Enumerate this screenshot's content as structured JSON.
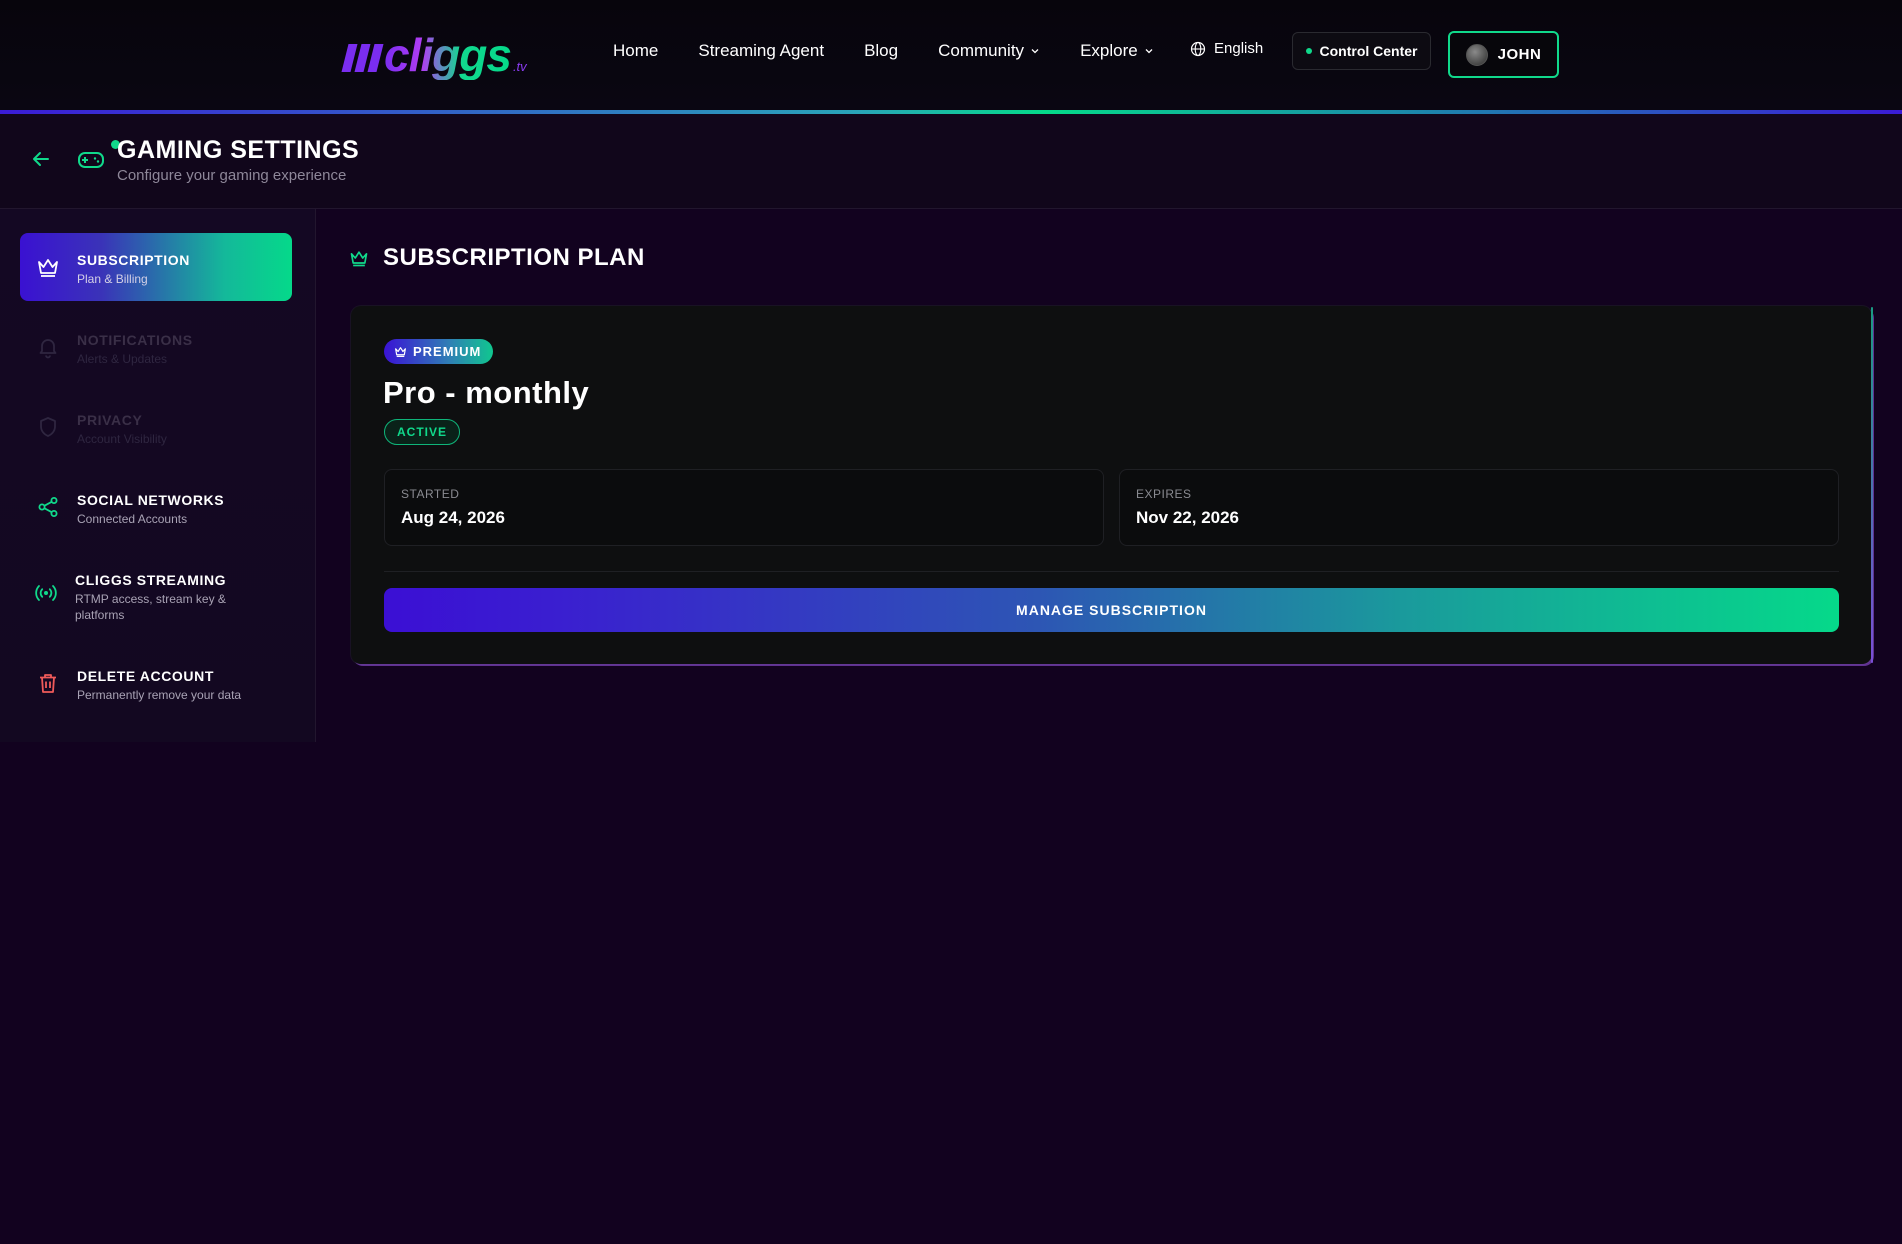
{
  "nav": {
    "logo_text": "cliggs",
    "logo_suffix": ".tv",
    "links": [
      "Home",
      "Streaming Agent",
      "Blog",
      "Community",
      "Explore"
    ],
    "language": "English",
    "control_center": "Control Center",
    "user_name": "JOHN"
  },
  "header": {
    "title": "GAMING SETTINGS",
    "subtitle": "Configure your gaming experience"
  },
  "sidebar": {
    "items": [
      {
        "title": "SUBSCRIPTION",
        "sub": "Plan & Billing",
        "icon": "crown-icon",
        "state": "active"
      },
      {
        "title": "NOTIFICATIONS",
        "sub": "Alerts & Updates",
        "icon": "bell-icon",
        "state": "disabled"
      },
      {
        "title": "PRIVACY",
        "sub": "Account Visibility",
        "icon": "shield-icon",
        "state": "disabled"
      },
      {
        "title": "SOCIAL NETWORKS",
        "sub": "Connected Accounts",
        "icon": "share-icon",
        "state": "normal"
      },
      {
        "title": "CLIGGS STREAMING",
        "sub": "RTMP access, stream key &",
        "sub2": "platforms",
        "icon": "broadcast-icon",
        "state": "normal"
      },
      {
        "title": "DELETE ACCOUNT",
        "sub": "Permanently remove your data",
        "icon": "trash-icon",
        "state": "danger"
      }
    ]
  },
  "main": {
    "section_title": "SUBSCRIPTION PLAN",
    "plan": {
      "badge": "PREMIUM",
      "name": "Pro - monthly",
      "status": "ACTIVE",
      "started_label": "STARTED",
      "started_value": "Aug 24, 2026",
      "expires_label": "EXPIRES",
      "expires_value": "Nov 22, 2026",
      "manage_label": "MANAGE SUBSCRIPTION"
    }
  },
  "colors": {
    "accent_green": "#10d98b",
    "accent_purple": "#3b0fd4",
    "danger": "#f05a5a",
    "background": "#12021f"
  }
}
